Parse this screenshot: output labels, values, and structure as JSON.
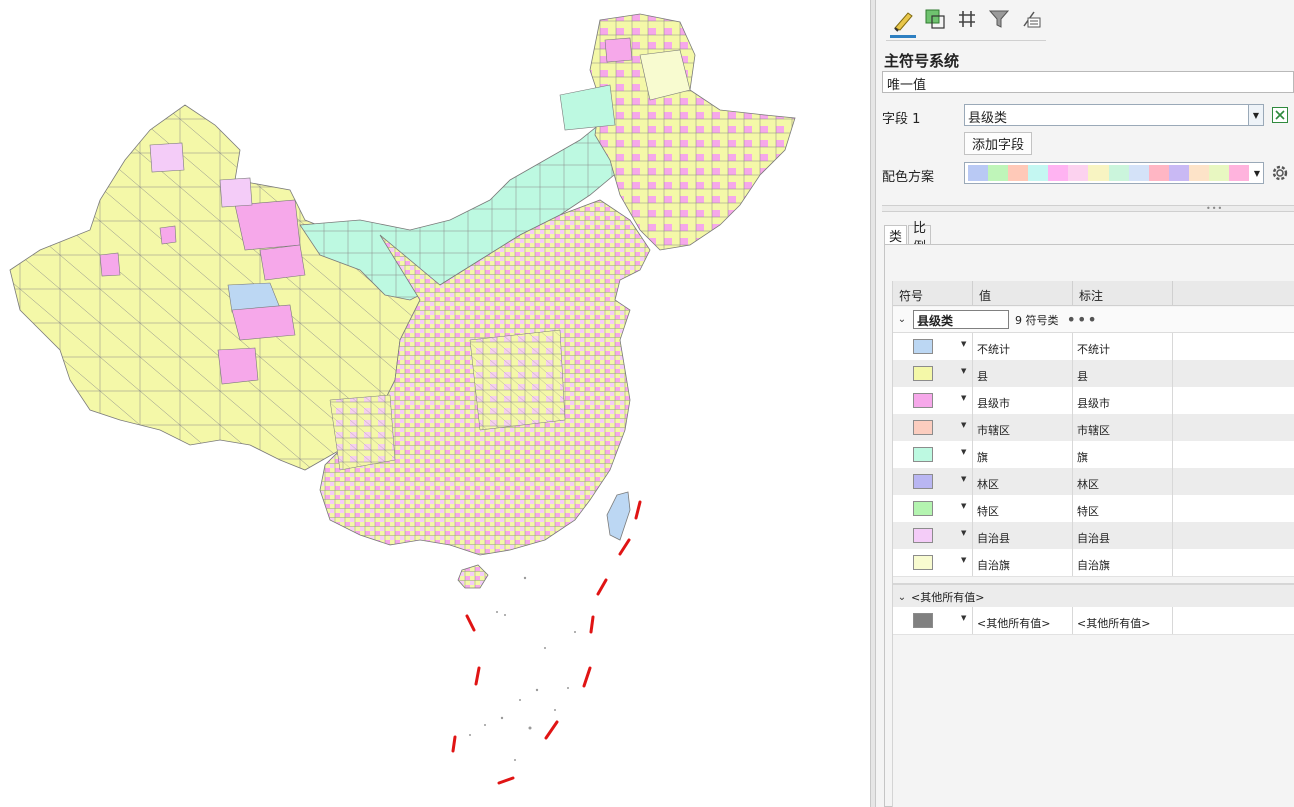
{
  "toolbar": {
    "tools": [
      {
        "icon": "primary-symbology-icon",
        "active": true
      },
      {
        "icon": "vary-symbology-icon",
        "active": false
      },
      {
        "icon": "symbol-layer-drawing-icon",
        "active": false
      },
      {
        "icon": "filter-icon",
        "active": false
      },
      {
        "icon": "advanced-symbology-icon",
        "active": false
      }
    ]
  },
  "symbology": {
    "title": "主符号系统",
    "renderer": "唯一值",
    "field_label": "字段 1",
    "field_value": "县级类",
    "add_field": "添加字段",
    "color_scheme_label": "配色方案",
    "color_scheme": [
      "#b9c9f4",
      "#bff5b9",
      "#ffc9b8",
      "#c4f7f2",
      "#ffb3f2",
      "#fcd2ef",
      "#f8f4c2",
      "#cbf5dc",
      "#d4e2f8",
      "#ffb6c4",
      "#c9b9f4",
      "#fde3c8",
      "#e8f7c1",
      "#ffb3dd"
    ]
  },
  "tabs": [
    "类",
    "比例"
  ],
  "table": {
    "headers": [
      "符号",
      "值",
      "标注"
    ],
    "group": {
      "name": "县级类",
      "count": "9 符号类",
      "more": "•••"
    },
    "rows": [
      {
        "value": "不统计",
        "label": "不统计",
        "color": "#bcd7f3"
      },
      {
        "value": "县",
        "label": "县",
        "color": "#f4f8a8"
      },
      {
        "value": "县级市",
        "label": "县级市",
        "color": "#f6a8ea"
      },
      {
        "value": "市辖区",
        "label": "市辖区",
        "color": "#fbcdbf"
      },
      {
        "value": "旗",
        "label": "旗",
        "color": "#bdf9e1"
      },
      {
        "value": "林区",
        "label": "林区",
        "color": "#b9b6f2"
      },
      {
        "value": "特区",
        "label": "特区",
        "color": "#b4f4b0"
      },
      {
        "value": "自治县",
        "label": "自治县",
        "color": "#f4ccf8"
      },
      {
        "value": "自治旗",
        "label": "自治旗",
        "color": "#f8fbd0"
      }
    ],
    "other": {
      "header": "<其他所有值>",
      "value": "<其他所有值>",
      "label": "<其他所有值>",
      "color": "#808080"
    }
  },
  "map": {
    "fill_colors": {
      "county": "#f4f8a8",
      "county_city": "#f6a8ea",
      "district": "#fbcdbf",
      "banner": "#bdf9e1",
      "autonomous_county": "#f4ccf8",
      "autonomous_banner": "#f8fbd0",
      "unknown": "#bcd7f3"
    },
    "boundary_color": "#7a7a7a",
    "dash_line_color": "#e01414"
  }
}
